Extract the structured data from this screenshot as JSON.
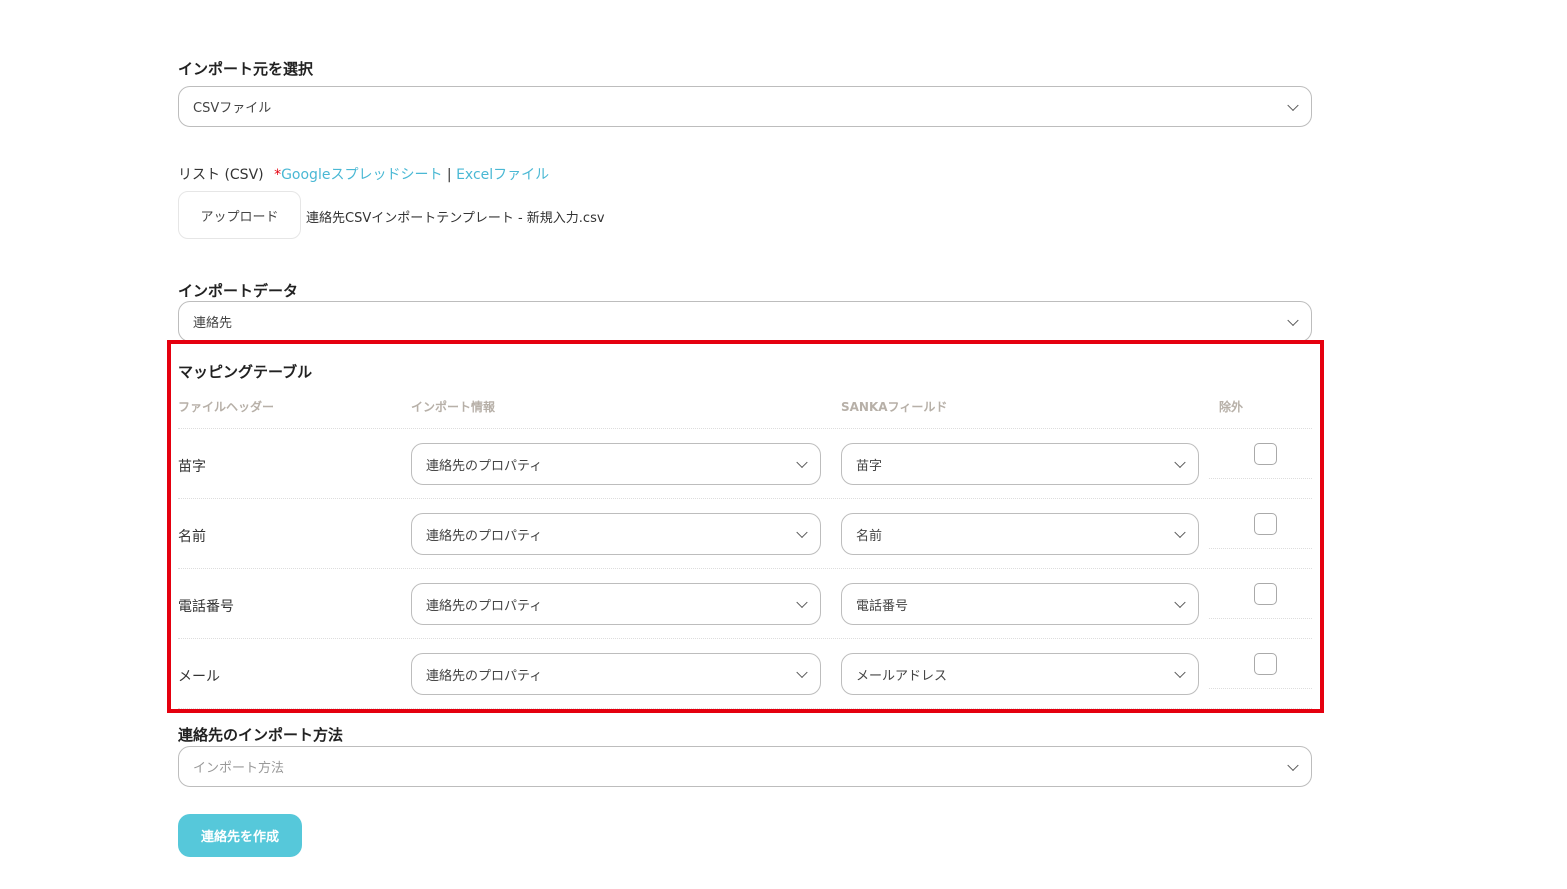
{
  "import_source": {
    "label": "インポート元を選択",
    "value": "CSVファイル"
  },
  "list": {
    "label": "リスト (CSV)",
    "required_mark": "*",
    "google_link": "Googleスプレッドシート",
    "separator": "|",
    "excel_link": "Excelファイル",
    "upload_button": "アップロード",
    "file_name": "連絡先CSVインポートテンプレート - 新規入力.csv"
  },
  "import_data": {
    "label": "インポートデータ",
    "value": "連絡先"
  },
  "mapping": {
    "title": "マッピングテーブル",
    "headers": [
      "ファイルヘッダー",
      "インポート情報",
      "SANKAフィールド",
      "除外"
    ],
    "rows": [
      {
        "header": "苗字",
        "import_info": "連絡先のプロパティ",
        "field": "苗字",
        "excluded": false
      },
      {
        "header": "名前",
        "import_info": "連絡先のプロパティ",
        "field": "名前",
        "excluded": false
      },
      {
        "header": "電話番号",
        "import_info": "連絡先のプロパティ",
        "field": "電話番号",
        "excluded": false
      },
      {
        "header": "メール",
        "import_info": "連絡先のプロパティ",
        "field": "メールアドレス",
        "excluded": false
      }
    ]
  },
  "import_method": {
    "label": "連絡先のインポート方法",
    "placeholder": "インポート方法"
  },
  "submit_button": "連絡先を作成",
  "colors": {
    "accent": "#56c8da",
    "link": "#4ab8d4",
    "highlight": "#e5000f"
  }
}
